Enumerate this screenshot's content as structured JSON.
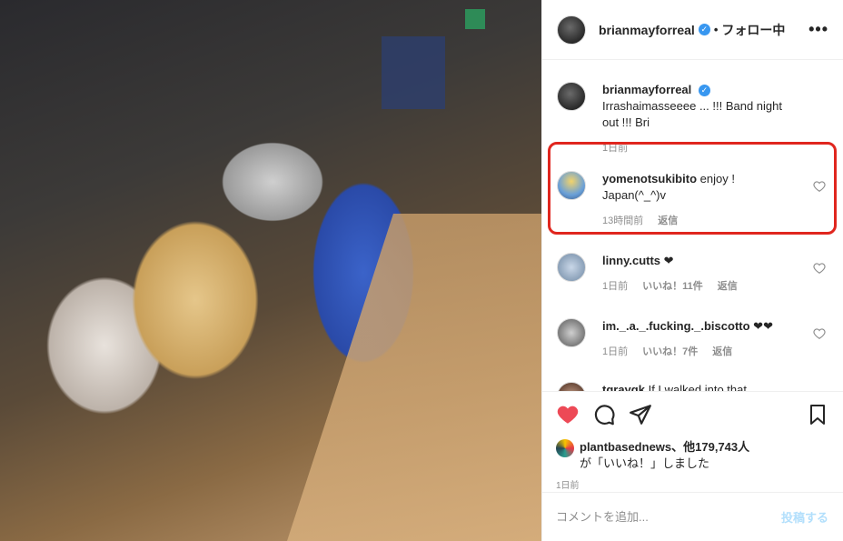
{
  "header": {
    "username": "brianmayforreal",
    "follow_status": "フォロー中",
    "more": "•••"
  },
  "caption": {
    "username": "brianmayforreal",
    "text": "Irrashaimasseeee ... !!! Band night out !!! Bri",
    "time": "1日前"
  },
  "comments": [
    {
      "username": "yomenotsukibito",
      "text": "enjoy ! Japan(^_^)v",
      "time": "13時間前",
      "likes": "",
      "reply": "返信"
    },
    {
      "username": "linny.cutts",
      "text": "❤",
      "time": "1日前",
      "likes": "いいね！11件",
      "reply": "返信"
    },
    {
      "username": "im._.a._.fucking._.biscotto",
      "text": "❤❤",
      "time": "1日前",
      "likes": "いいね！7件",
      "reply": "返信"
    },
    {
      "username": "tgraygk",
      "text": "If I walked into that",
      "time": "",
      "likes": "",
      "reply": ""
    }
  ],
  "likes": {
    "users": "plantbasednews、他179,743人",
    "suffix": "が「いいね！」しました",
    "time": "1日前"
  },
  "add_comment": {
    "placeholder": "コメントを追加...",
    "post_label": "投稿する"
  },
  "colors": {
    "highlight": "#e0261e",
    "liked_heart": "#ed4956",
    "verified": "#3897f0"
  }
}
